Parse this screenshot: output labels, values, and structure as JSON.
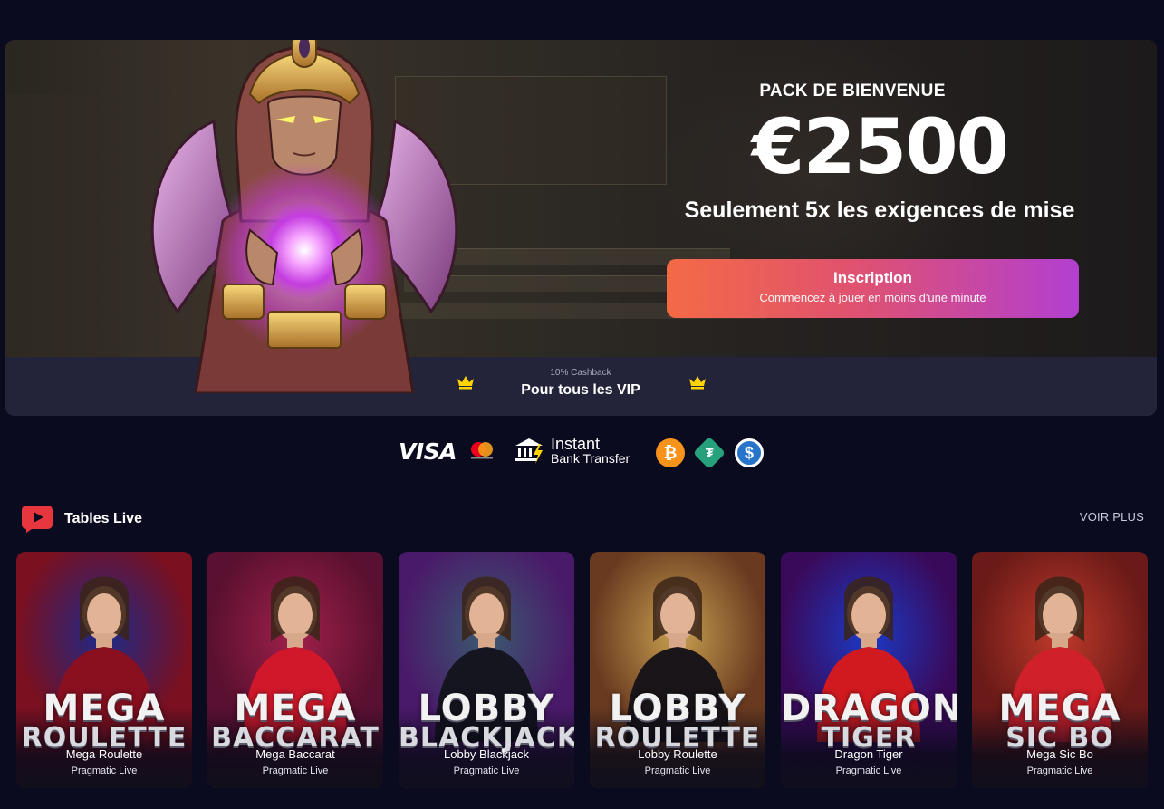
{
  "hero": {
    "kicker": "PACK DE BIENVENUE",
    "amount": "€2500",
    "subtitle": "Seulement 5x les exigences de mise",
    "cta_title": "Inscription",
    "cta_subtitle": "Commencez à jouer en moins d'une minute",
    "cashback_small": "10% Cashback",
    "cashback_main": "Pour tous les VIP"
  },
  "payments": {
    "visa": "VISA",
    "bank_line1": "Instant",
    "bank_line2": "Bank Transfer",
    "coins": [
      {
        "icon": "bitcoin-icon",
        "glyph": "₿",
        "color": "#f7931a"
      },
      {
        "icon": "tether-icon",
        "glyph": "₮",
        "color": "#26a17b"
      },
      {
        "icon": "usdc-icon",
        "glyph": "$",
        "color": "#2775ca"
      }
    ]
  },
  "section": {
    "title": "Tables Live",
    "see_more": "VOIR PLUS"
  },
  "games": [
    {
      "logo1": "MEGA",
      "logo2": "ROULETTE",
      "name": "Mega Roulette",
      "provider": "Pragmatic Live",
      "bg1": "#1b2a8a",
      "bg2": "#7a1020",
      "outfit": "#8a1020"
    },
    {
      "logo1": "MEGA",
      "logo2": "BACCARAT",
      "name": "Mega Baccarat",
      "provider": "Pragmatic Live",
      "bg1": "#a0204a",
      "bg2": "#5a1030",
      "outfit": "#d0182a"
    },
    {
      "logo1": "LOBBY",
      "logo2": "BLACKJACK",
      "name": "Lobby Blackjack",
      "provider": "Pragmatic Live",
      "bg1": "#3a5a70",
      "bg2": "#4a1a6a",
      "outfit": "#151520"
    },
    {
      "logo1": "LOBBY",
      "logo2": "ROULETTE",
      "name": "Lobby Roulette",
      "provider": "Pragmatic Live",
      "bg1": "#c8a050",
      "bg2": "#6a3a20",
      "outfit": "#1a1518"
    },
    {
      "logo1": "DRAGON",
      "logo2": "TIGER",
      "name": "Dragon Tiger",
      "provider": "Pragmatic Live",
      "bg1": "#1a3ac8",
      "bg2": "#3a0a5a",
      "outfit": "#d01a20"
    },
    {
      "logo1": "MEGA",
      "logo2": "SIC BO",
      "name": "Mega Sic Bo",
      "provider": "Pragmatic Live",
      "bg1": "#c03a2a",
      "bg2": "#6a1a18",
      "outfit": "#d0202a"
    }
  ],
  "colors": {
    "page_bg": "#0b0b1f",
    "strip_bg": "#23243a",
    "cta_gradient_start": "#f46a46",
    "cta_gradient_end": "#b23fd0",
    "crown": "#ffd400"
  }
}
